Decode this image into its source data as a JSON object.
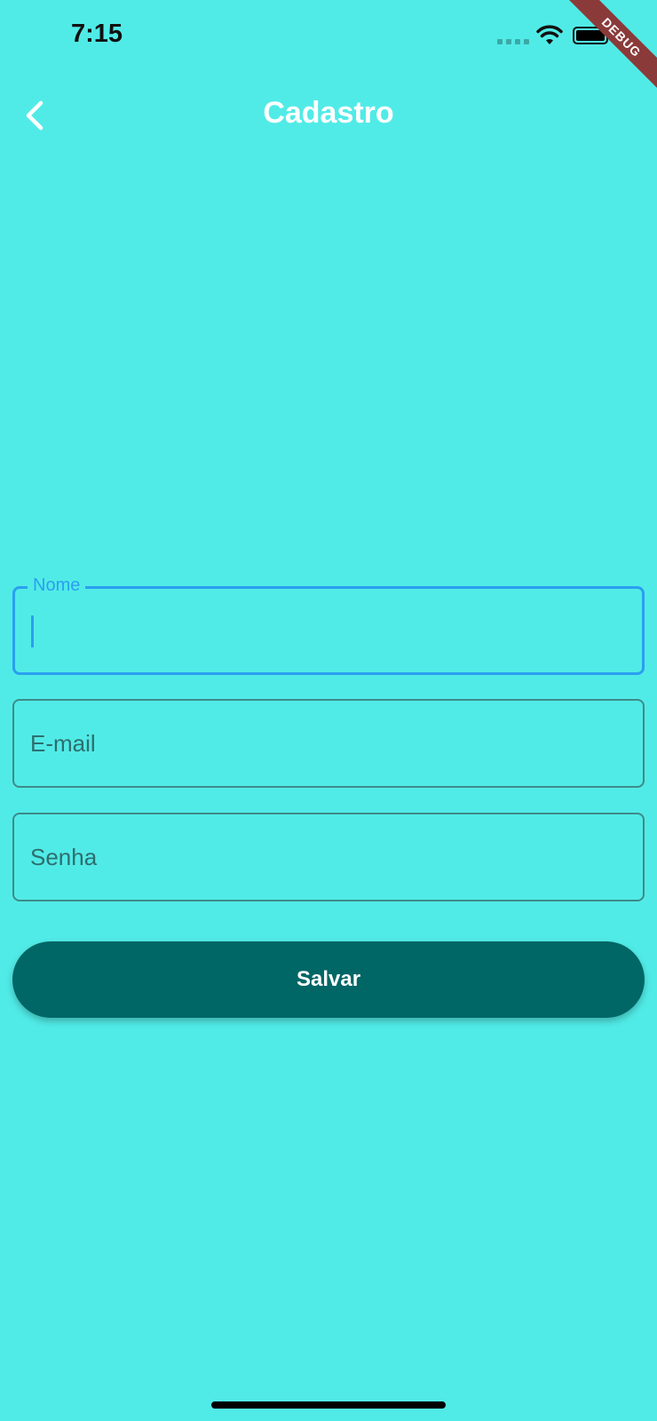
{
  "status_bar": {
    "time": "7:15",
    "debug_label": "DEBUG"
  },
  "app_bar": {
    "title": "Cadastro",
    "back_icon": "chevron-left-icon"
  },
  "form": {
    "name_field": {
      "label": "Nome",
      "value": ""
    },
    "email_field": {
      "placeholder": "E-mail",
      "value": ""
    },
    "password_field": {
      "placeholder": "Senha",
      "value": ""
    },
    "save_label": "Salvar"
  },
  "colors": {
    "background": "#51ebe7",
    "accent_focus": "#2a9ff0",
    "button": "#006666"
  }
}
